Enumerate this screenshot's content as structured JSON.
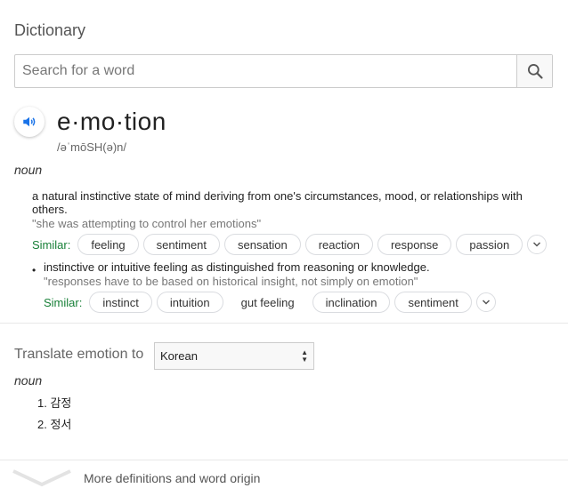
{
  "card": {
    "title": "Dictionary"
  },
  "search": {
    "placeholder": "Search for a word",
    "value": ""
  },
  "entry": {
    "word": "e·mo·tion",
    "phonetic": "/əˈmōSH(ə)n/",
    "part_of_speech": "noun",
    "definitions": [
      {
        "text": "a natural instinctive state of mind deriving from one's circumstances, mood, or relationships with others.",
        "example": "\"she was attempting to control her emotions\"",
        "similar_label": "Similar:",
        "similar": [
          "feeling",
          "sentiment",
          "sensation",
          "reaction",
          "response",
          "passion"
        ]
      },
      {
        "bullet": "•",
        "text": "instinctive or intuitive feeling as distinguished from reasoning or knowledge.",
        "example": "\"responses have to be based on historical insight, not simply on emotion\"",
        "similar_label": "Similar:",
        "similar": [
          "instinct",
          "intuition",
          "gut feeling",
          "inclination",
          "sentiment"
        ]
      }
    ]
  },
  "translate": {
    "label": "Translate emotion to",
    "language": "Korean",
    "part_of_speech": "noun",
    "items": [
      "1. 감정",
      "2. 정서"
    ]
  },
  "footer": {
    "more_label": "More definitions and word origin"
  },
  "colors": {
    "similar_green": "#188038",
    "speaker_blue": "#1a73e8"
  },
  "icons": [
    "search-icon",
    "speaker-icon",
    "chevron-down-icon",
    "select-arrows-icon"
  ]
}
